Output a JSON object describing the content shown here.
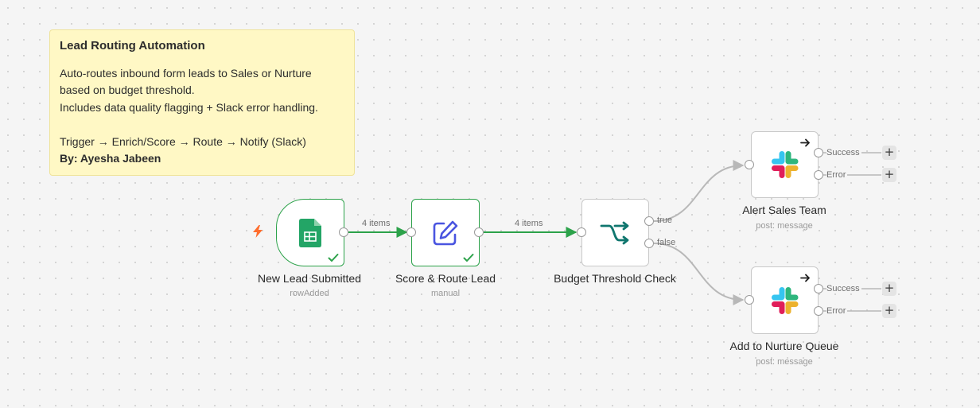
{
  "sticky_note": {
    "title": "Lead Routing Automation",
    "lines": [
      "Auto-routes inbound form leads to Sales or Nurture",
      "based on budget threshold.",
      "Includes data quality flagging + Slack error handling.",
      "",
      "Trigger → Enrich/Score → Route → Notify (Slack)"
    ],
    "author": "By: Ayesha Jabeen"
  },
  "nodes": {
    "trigger": {
      "label": "New Lead Submitted",
      "subtitle": "rowAdded",
      "icon": "google-sheets-icon"
    },
    "score": {
      "label": "Score & Route Lead",
      "subtitle": "manual",
      "icon": "edit-icon"
    },
    "budget": {
      "label": "Budget Threshold Check",
      "icon": "if-branch-icon"
    },
    "alert": {
      "label": "Alert Sales Team",
      "subtitle": "post: message",
      "icon": "slack-icon"
    },
    "nurture": {
      "label": "Add to Nurture Queue",
      "subtitle": "post: message",
      "icon": "slack-icon"
    }
  },
  "connections": {
    "trigger_to_score": "4 items",
    "score_to_budget": "4 items"
  },
  "branches": {
    "true_label": "true",
    "false_label": "false"
  },
  "outputs": {
    "success_label": "Success",
    "error_label": "Error",
    "plus": "+"
  },
  "colors": {
    "success_green": "#2ca24a",
    "sheets_green": "#23a566",
    "edit_blue": "#4a55e0",
    "if_teal": "#0f766e",
    "trigger_orange": "#ff6d2d",
    "sticky_yellow": "#fff8c5"
  }
}
